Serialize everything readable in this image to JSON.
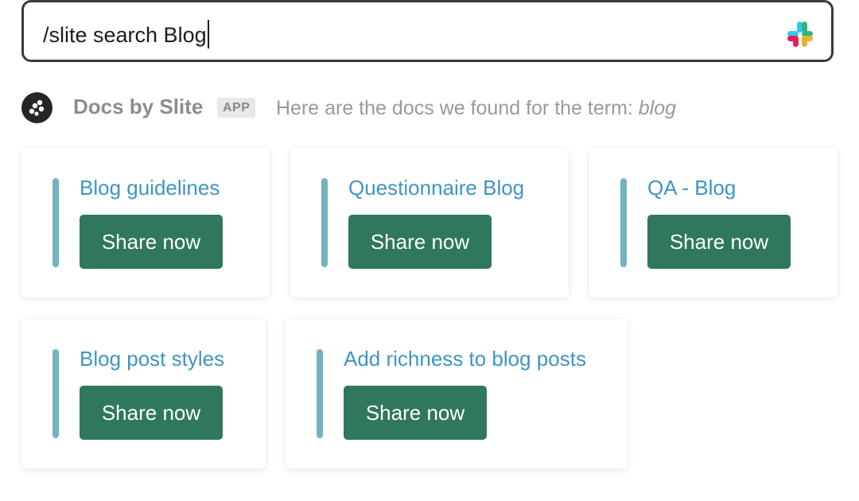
{
  "command": {
    "text": "/slite search Blog",
    "icon": "slack-icon"
  },
  "app": {
    "name": "Docs by Slite",
    "badge": "APP",
    "message_prefix": "Here are the docs we found for the term: ",
    "term": "blog",
    "avatar_icon": "slite-logo-icon"
  },
  "results": [
    {
      "title": "Blog guidelines",
      "button": "Share now"
    },
    {
      "title": "Questionnaire Blog",
      "button": "Share now"
    },
    {
      "title": "QA - Blog",
      "button": "Share now"
    },
    {
      "title": "Blog post styles",
      "button": "Share now"
    },
    {
      "title": "Add richness to blog posts",
      "button": "Share now"
    }
  ],
  "colors": {
    "link": "#3e95c3",
    "button": "#2f785b",
    "accent_bar": "#73b3bf"
  }
}
